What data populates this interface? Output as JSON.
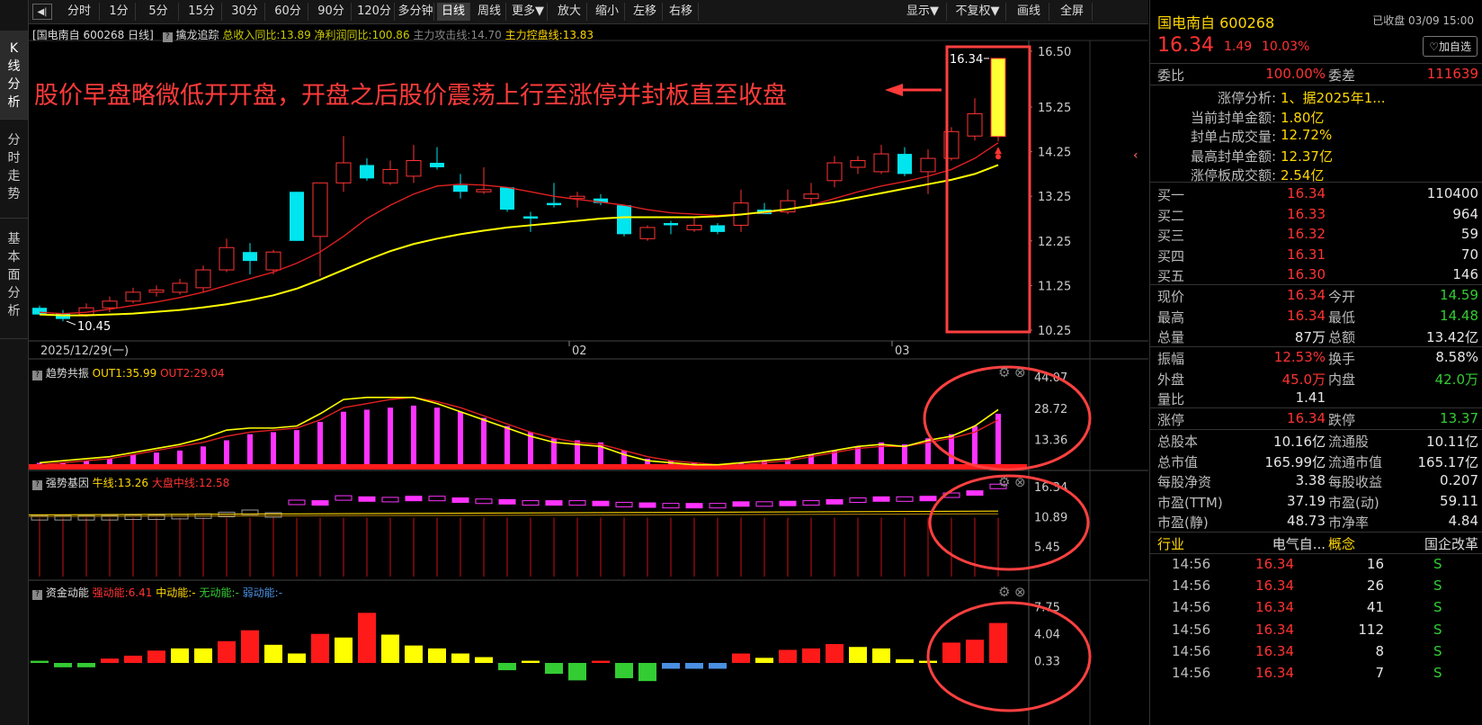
{
  "toolbar": {
    "buttons": [
      "分时",
      "1分",
      "5分",
      "15分",
      "30分",
      "60分",
      "90分",
      "120分",
      "多分钟",
      "日线",
      "周线",
      "更多▼",
      "放大",
      "缩小",
      "左移",
      "右移"
    ],
    "active": "日线",
    "right_buttons": [
      "显示▼",
      "不复权▼",
      "画线",
      "全屏"
    ]
  },
  "left_rail": {
    "tabs": [
      "K线分析",
      "分时走势",
      "基本面分析"
    ]
  },
  "main_chart": {
    "header_stock": "[国电南自 600268 日线]",
    "indicator_name": "擒龙追踪",
    "items": [
      {
        "text": "总收入同比:13.89",
        "color": "#cccc00"
      },
      {
        "text": "净利润同比:100.86",
        "color": "#cccc00"
      },
      {
        "text": "主力攻击线:14.70",
        "color": "#888888"
      },
      {
        "text": "主力控盘线:13.83",
        "color": "#ffd700"
      }
    ],
    "annotation": "股价早盘略微低开开盘，开盘之后股价震荡上行至涨停并封板直至收盘",
    "price_high_label": "16.34",
    "price_low_label": "10.45",
    "y_ticks": [
      "16.50",
      "15.25",
      "14.25",
      "13.25",
      "12.25",
      "11.25",
      "10.25"
    ],
    "date_labels": [
      "2025/12/29(一)",
      "02",
      "03"
    ]
  },
  "panel_trend": {
    "name": "趋势共振",
    "out1": "OUT1:35.99",
    "out2": "OUT2:29.04",
    "y_ticks": [
      "44.07",
      "28.72",
      "13.36"
    ]
  },
  "panel_strong": {
    "name": "强势基因",
    "bull": "牛线:13.26",
    "market": "大盘中线:12.58",
    "y_ticks": [
      "16.34",
      "10.89",
      "5.45"
    ]
  },
  "panel_fund": {
    "name": "资金动能",
    "strong": "强动能:6.41",
    "mid": "中动能:-",
    "none": "无动能:-",
    "weak": "弱动能:-",
    "y_ticks": [
      "7.75",
      "4.04",
      "0.33"
    ]
  },
  "chart_data": {
    "type": "candlestick",
    "candles": [
      {
        "o": 10.75,
        "h": 10.8,
        "l": 10.6,
        "c": 10.6
      },
      {
        "o": 10.62,
        "h": 10.7,
        "l": 10.45,
        "c": 10.5
      },
      {
        "o": 10.6,
        "h": 10.85,
        "l": 10.55,
        "c": 10.75
      },
      {
        "o": 10.75,
        "h": 11.0,
        "l": 10.65,
        "c": 10.9
      },
      {
        "o": 10.9,
        "h": 11.2,
        "l": 10.85,
        "c": 11.1
      },
      {
        "o": 11.1,
        "h": 11.25,
        "l": 11.0,
        "c": 11.15
      },
      {
        "o": 11.1,
        "h": 11.4,
        "l": 11.05,
        "c": 11.3
      },
      {
        "o": 11.2,
        "h": 11.7,
        "l": 11.1,
        "c": 11.6
      },
      {
        "o": 11.6,
        "h": 12.3,
        "l": 11.55,
        "c": 12.1
      },
      {
        "o": 12.0,
        "h": 12.2,
        "l": 11.5,
        "c": 11.8
      },
      {
        "o": 11.6,
        "h": 12.05,
        "l": 11.5,
        "c": 12.0
      },
      {
        "o": 13.35,
        "h": 13.35,
        "l": 12.25,
        "c": 12.25
      },
      {
        "o": 12.35,
        "h": 13.55,
        "l": 11.45,
        "c": 13.55
      },
      {
        "o": 13.55,
        "h": 14.6,
        "l": 13.35,
        "c": 14.0
      },
      {
        "o": 13.95,
        "h": 14.1,
        "l": 13.6,
        "c": 13.65
      },
      {
        "o": 13.55,
        "h": 14.05,
        "l": 13.5,
        "c": 13.85
      },
      {
        "o": 13.7,
        "h": 14.4,
        "l": 13.55,
        "c": 14.05
      },
      {
        "o": 14.0,
        "h": 14.35,
        "l": 13.85,
        "c": 13.9
      },
      {
        "o": 13.5,
        "h": 13.75,
        "l": 13.2,
        "c": 13.35
      },
      {
        "o": 13.35,
        "h": 13.9,
        "l": 13.3,
        "c": 13.4
      },
      {
        "o": 13.45,
        "h": 13.45,
        "l": 12.9,
        "c": 12.95
      },
      {
        "o": 12.8,
        "h": 12.9,
        "l": 12.45,
        "c": 12.75
      },
      {
        "o": 13.1,
        "h": 13.55,
        "l": 13.0,
        "c": 13.05
      },
      {
        "o": 13.2,
        "h": 13.35,
        "l": 13.0,
        "c": 13.25
      },
      {
        "o": 13.2,
        "h": 13.3,
        "l": 13.05,
        "c": 13.1
      },
      {
        "o": 13.05,
        "h": 13.05,
        "l": 12.35,
        "c": 12.4
      },
      {
        "o": 12.3,
        "h": 12.6,
        "l": 12.25,
        "c": 12.55
      },
      {
        "o": 12.65,
        "h": 12.7,
        "l": 12.4,
        "c": 12.6
      },
      {
        "o": 12.5,
        "h": 12.8,
        "l": 12.45,
        "c": 12.6
      },
      {
        "o": 12.6,
        "h": 12.65,
        "l": 12.4,
        "c": 12.45
      },
      {
        "o": 12.6,
        "h": 13.4,
        "l": 12.45,
        "c": 13.1
      },
      {
        "o": 12.95,
        "h": 13.1,
        "l": 12.85,
        "c": 12.85
      },
      {
        "o": 12.9,
        "h": 13.4,
        "l": 12.85,
        "c": 13.15
      },
      {
        "o": 13.2,
        "h": 13.55,
        "l": 13.05,
        "c": 13.3
      },
      {
        "o": 13.6,
        "h": 14.15,
        "l": 13.45,
        "c": 14.0
      },
      {
        "o": 13.9,
        "h": 14.15,
        "l": 13.75,
        "c": 14.05
      },
      {
        "o": 13.8,
        "h": 14.4,
        "l": 13.75,
        "c": 14.2
      },
      {
        "o": 14.2,
        "h": 14.35,
        "l": 13.7,
        "c": 13.75
      },
      {
        "o": 13.8,
        "h": 14.3,
        "l": 13.3,
        "c": 14.1
      },
      {
        "o": 14.1,
        "h": 14.8,
        "l": 14.05,
        "c": 14.7
      },
      {
        "o": 14.6,
        "h": 15.45,
        "l": 14.5,
        "c": 15.1
      },
      {
        "o": 14.59,
        "h": 16.34,
        "l": 14.48,
        "c": 16.34
      }
    ],
    "ma_red": [
      10.65,
      10.62,
      10.65,
      10.72,
      10.8,
      10.88,
      10.98,
      11.1,
      11.25,
      11.4,
      11.55,
      11.75,
      12.0,
      12.35,
      12.75,
      13.05,
      13.3,
      13.48,
      13.52,
      13.5,
      13.45,
      13.35,
      13.25,
      13.18,
      13.12,
      13.05,
      12.95,
      12.88,
      12.85,
      12.82,
      12.85,
      12.88,
      12.95,
      13.05,
      13.2,
      13.35,
      13.48,
      13.58,
      13.7,
      13.85,
      14.1,
      14.45
    ],
    "ma_yellow": [
      10.6,
      10.58,
      10.58,
      10.6,
      10.62,
      10.66,
      10.7,
      10.76,
      10.83,
      10.92,
      11.03,
      11.18,
      11.38,
      11.6,
      11.82,
      12.02,
      12.18,
      12.3,
      12.4,
      12.48,
      12.55,
      12.6,
      12.65,
      12.7,
      12.75,
      12.78,
      12.78,
      12.78,
      12.78,
      12.8,
      12.84,
      12.9,
      12.96,
      13.04,
      13.12,
      13.22,
      13.32,
      13.42,
      13.52,
      13.62,
      13.75,
      13.95
    ],
    "trend_bars": [
      2,
      2,
      3,
      4,
      6,
      7,
      8,
      10,
      13,
      16,
      17,
      18,
      22,
      27,
      28,
      29,
      30,
      29,
      27,
      24,
      20,
      17,
      14,
      13,
      12,
      8,
      4,
      3,
      2,
      1,
      2,
      3,
      4,
      6,
      8,
      10,
      12,
      11,
      14,
      16,
      20,
      26
    ],
    "trend_yellow": [
      2,
      3,
      4,
      5,
      7,
      9,
      11,
      14,
      18,
      19,
      19,
      20,
      26,
      33,
      34,
      34,
      34,
      31,
      27,
      23,
      19,
      15,
      12,
      11,
      10,
      6,
      3,
      2,
      1,
      1,
      2,
      3,
      4,
      6,
      8,
      10,
      11,
      10,
      13,
      15,
      20,
      28
    ],
    "trend_red": [
      1,
      2,
      3,
      4,
      6,
      8,
      10,
      12,
      15,
      17,
      18,
      19,
      23,
      29,
      31,
      33,
      34,
      32,
      29,
      25,
      21,
      17,
      14,
      12,
      11,
      8,
      5,
      3,
      2,
      1,
      1,
      2,
      3,
      5,
      7,
      9,
      10,
      10,
      12,
      14,
      17,
      23
    ],
    "strong_bars": [
      10.6,
      10.6,
      10.6,
      10.6,
      10.7,
      10.7,
      10.8,
      10.9,
      11.2,
      11.6,
      11.1,
      13.4,
      13.3,
      14.2,
      14.0,
      13.9,
      14.1,
      14.1,
      13.8,
      13.6,
      13.5,
      13.3,
      13.3,
      13.3,
      13.2,
      13.0,
      12.9,
      12.8,
      12.8,
      12.8,
      13.1,
      13.1,
      13.2,
      13.3,
      13.5,
      13.8,
      14.0,
      14.0,
      14.1,
      14.7,
      15.1,
      16.3
    ],
    "fund_bars": [
      0.3,
      -0.6,
      -0.6,
      0.6,
      1.0,
      1.7,
      2.0,
      2.0,
      3.0,
      4.5,
      2.5,
      1.3,
      4.0,
      3.5,
      6.9,
      3.9,
      2.4,
      2.0,
      1.3,
      0.8,
      -1.0,
      0.3,
      -1.5,
      -2.4,
      0.3,
      -2.1,
      -2.5,
      -0.8,
      -0.8,
      -0.8,
      1.3,
      0.7,
      1.8,
      2.0,
      2.6,
      2.2,
      2.0,
      0.5,
      0.3,
      2.8,
      3.2,
      5.5
    ]
  },
  "quote": {
    "name_code": "国电南自 600268",
    "status": "已收盘 03/09 15:00",
    "price": "16.34",
    "change": "1.49",
    "change_pct": "10.03%",
    "add_btn": "♡加自选",
    "weibi_label": "委比",
    "weibi": "100.00%",
    "weicha_label": "委差",
    "weicha": "111639",
    "limit_info": [
      {
        "label": "涨停分析:",
        "value": "1、据2025年1..."
      },
      {
        "label": "当前封单金额:",
        "value": "1.80亿"
      },
      {
        "label": "封单占成交量:",
        "value": "12.72%"
      },
      {
        "label": "最高封单金额:",
        "value": "12.37亿"
      },
      {
        "label": "涨停板成交额:",
        "value": "2.54亿"
      }
    ],
    "bids": [
      {
        "label": "买一",
        "price": "16.34",
        "vol": "110400"
      },
      {
        "label": "买二",
        "price": "16.33",
        "vol": "964"
      },
      {
        "label": "买三",
        "price": "16.32",
        "vol": "59"
      },
      {
        "label": "买四",
        "price": "16.31",
        "vol": "70"
      },
      {
        "label": "买五",
        "price": "16.30",
        "vol": "146"
      }
    ],
    "stats": [
      {
        "l1": "现价",
        "v1": "16.34",
        "c1": "red",
        "l2": "今开",
        "v2": "14.59",
        "c2": "green"
      },
      {
        "l1": "最高",
        "v1": "16.34",
        "c1": "red",
        "l2": "最低",
        "v2": "14.48",
        "c2": "green"
      },
      {
        "l1": "总量",
        "v1": "87万",
        "c1": "white",
        "l2": "总额",
        "v2": "13.42亿",
        "c2": "white"
      }
    ],
    "stats2": [
      {
        "l1": "振幅",
        "v1": "12.53%",
        "c1": "red",
        "l2": "换手",
        "v2": "8.58%",
        "c2": "white"
      },
      {
        "l1": "外盘",
        "v1": "45.0万",
        "c1": "red",
        "l2": "内盘",
        "v2": "42.0万",
        "c2": "green"
      },
      {
        "l1": "量比",
        "v1": "1.41",
        "c1": "white",
        "l2": "",
        "v2": "",
        "c2": "white"
      }
    ],
    "limit_row": {
      "l1": "涨停",
      "v1": "16.34",
      "l2": "跌停",
      "v2": "13.37"
    },
    "fundamentals": [
      {
        "l1": "总股本",
        "v1": "10.16亿",
        "l2": "流通股",
        "v2": "10.11亿"
      },
      {
        "l1": "总市值",
        "v1": "165.99亿",
        "l2": "流通市值",
        "v2": "165.17亿"
      },
      {
        "l1": "每股净资",
        "v1": "3.38",
        "l2": "每股收益",
        "v2": "0.207"
      },
      {
        "l1": "市盈(TTM)",
        "v1": "37.19",
        "l2": "市盈(动)",
        "v2": "59.11"
      },
      {
        "l1": "市盈(静)",
        "v1": "48.73",
        "l2": "市净率",
        "v2": "4.84"
      }
    ],
    "industry_label": "行业",
    "industry": "电气自...",
    "concept_label": "概念",
    "concept": "国企改革",
    "ticks": [
      {
        "time": "14:56",
        "price": "16.34",
        "vol": "16",
        "flag": "S"
      },
      {
        "time": "14:56",
        "price": "16.34",
        "vol": "26",
        "flag": "S"
      },
      {
        "time": "14:56",
        "price": "16.34",
        "vol": "41",
        "flag": "S"
      },
      {
        "time": "14:56",
        "price": "16.34",
        "vol": "112",
        "flag": "S"
      },
      {
        "time": "14:56",
        "price": "16.34",
        "vol": "8",
        "flag": "S"
      },
      {
        "time": "14:56",
        "price": "16.34",
        "vol": "7",
        "flag": "S"
      }
    ]
  }
}
